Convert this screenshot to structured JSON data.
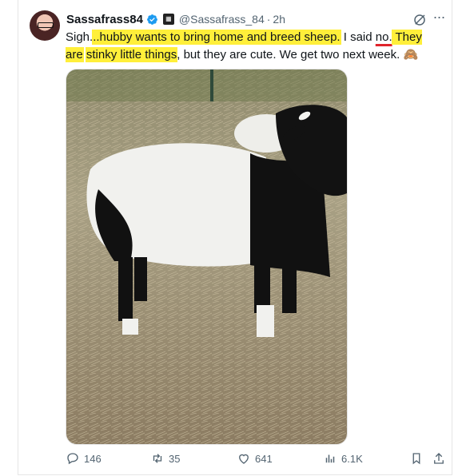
{
  "tweet": {
    "author_name": "Sassafrass84",
    "handle": "@Sassafrass_84",
    "separator": "·",
    "time": "2h",
    "text_parts": [
      "Sigh.",
      "..hubby wants to bring home and breed sheep.",
      " I said ",
      "no.",
      " They are",
      " ",
      "stinky little things",
      ", but they are cute. We get two next week. "
    ],
    "emoji": "🙈"
  },
  "media": {
    "description_icon": "sheep-photo"
  },
  "actions": {
    "replies": "146",
    "retweets": "35",
    "likes": "641",
    "views": "6.1K"
  },
  "colors": {
    "highlight": "#ffef3a",
    "underline": "#e0242b",
    "verified": "#1d9bf0",
    "muted": "#536471"
  }
}
